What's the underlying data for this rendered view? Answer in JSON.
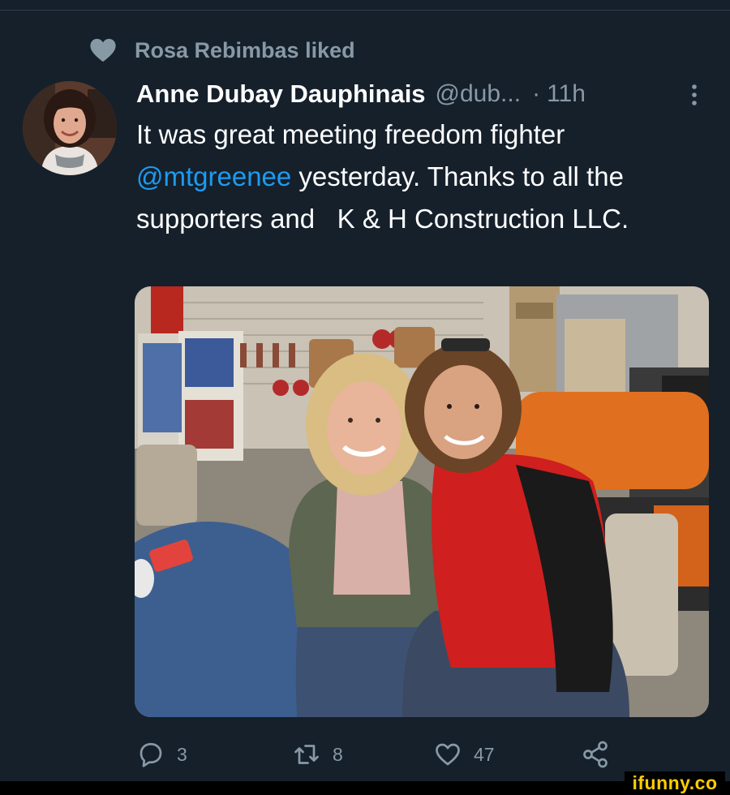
{
  "social_context": {
    "text": "Rosa Rebimbas liked"
  },
  "tweet": {
    "display_name": "Anne Dubay Dauphinais",
    "handle": "@dub...",
    "separator": "·",
    "time": "11h",
    "text_part1": "It was great meeting freedom fighter ",
    "mention": "@mtgreenee",
    "text_part2": " yesterday. Thanks to all the supporters and   K & H Construction LLC."
  },
  "actions": {
    "replies": "3",
    "retweets": "8",
    "likes": "47"
  },
  "watermark": "ifunny.co",
  "icons": {
    "social_context": "heart-icon",
    "more": "more-vertical-icon",
    "reply": "reply-icon",
    "retweet": "retweet-icon",
    "like": "like-icon",
    "share": "share-icon"
  },
  "colors": {
    "background": "#15202b",
    "secondary_text": "#8899a6",
    "mention": "#1d9bf0",
    "watermark": "#ffcc00"
  }
}
